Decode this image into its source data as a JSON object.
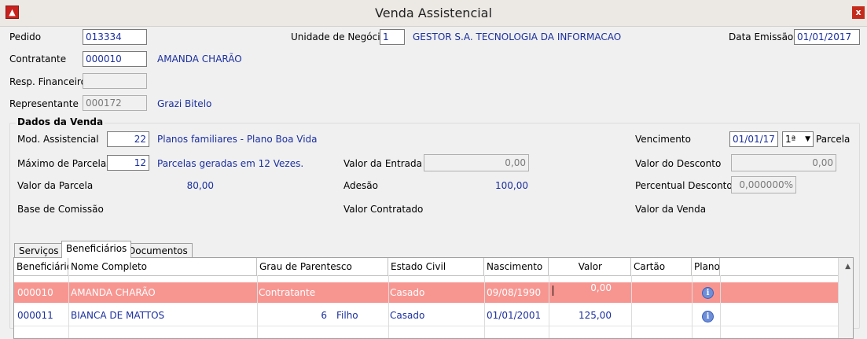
{
  "window": {
    "title": "Venda Assistencial",
    "close_label": "x"
  },
  "header": {
    "pedido_label": "Pedido",
    "pedido_value": "013334",
    "unidade_label": "Unidade de Negócio",
    "unidade_value": "1",
    "unidade_name": "GESTOR S.A. TECNOLOGIA DA INFORMACAO",
    "data_emissao_label": "Data Emissão",
    "data_emissao_value": "01/01/2017",
    "contratante_label": "Contratante",
    "contratante_value": "000010",
    "contratante_name": "AMANDA CHARÃO",
    "resp_label": "Resp. Financeiro",
    "resp_value": "",
    "representante_label": "Representante",
    "representante_value": "000172",
    "representante_name": "Grazi Bitelo"
  },
  "venda": {
    "group_title": "Dados da Venda",
    "mod_label": "Mod. Assistencial",
    "mod_value": "22",
    "mod_desc": "Planos familiares - Plano Boa Vida",
    "max_parcelas_label": "Máximo de Parcelas",
    "max_parcelas_value": "12",
    "max_parcelas_desc": "Parcelas geradas em 12 Vezes.",
    "valor_parcela_label": "Valor da Parcela",
    "valor_parcela_value": "80,00",
    "base_comissao_label": "Base de Comissão",
    "valor_entrada_label": "Valor da Entrada",
    "valor_entrada_value": "0,00",
    "adesao_label": "Adesão",
    "adesao_value": "100,00",
    "valor_contratado_label": "Valor Contratado",
    "vencimento_label": "Vencimento",
    "vencimento_value": "01/01/17",
    "parcela_select": "1ª",
    "parcela_label": "Parcela",
    "valor_desconto_label": "Valor do Desconto",
    "valor_desconto_value": "0,00",
    "percentual_label": "Percentual Desconto",
    "percentual_value": "0,000000%",
    "valor_venda_label": "Valor da Venda"
  },
  "tabs": [
    {
      "label": "Serviços"
    },
    {
      "label": "Beneficiários"
    },
    {
      "label": "Documentos"
    }
  ],
  "grid": {
    "columns": [
      "Beneficiário",
      "Nome Completo",
      "Grau de Parentesco",
      "Estado Civil",
      "Nascimento",
      "Valor",
      "Cartão",
      "Plano"
    ],
    "rows": [
      {
        "beneficiario": "000010",
        "nome": "AMANDA CHARÃO",
        "grau": "Contratante",
        "estado": "Casado",
        "nascimento": "09/08/1990",
        "valor": "0,00",
        "cartao": ""
      },
      {
        "beneficiario": "000011",
        "nome": "BIANCA DE MATTOS",
        "grau_num": "6",
        "grau": "Filho",
        "estado": "Casado",
        "nascimento": "01/01/2001",
        "valor": "125,00",
        "cartao": ""
      }
    ]
  }
}
